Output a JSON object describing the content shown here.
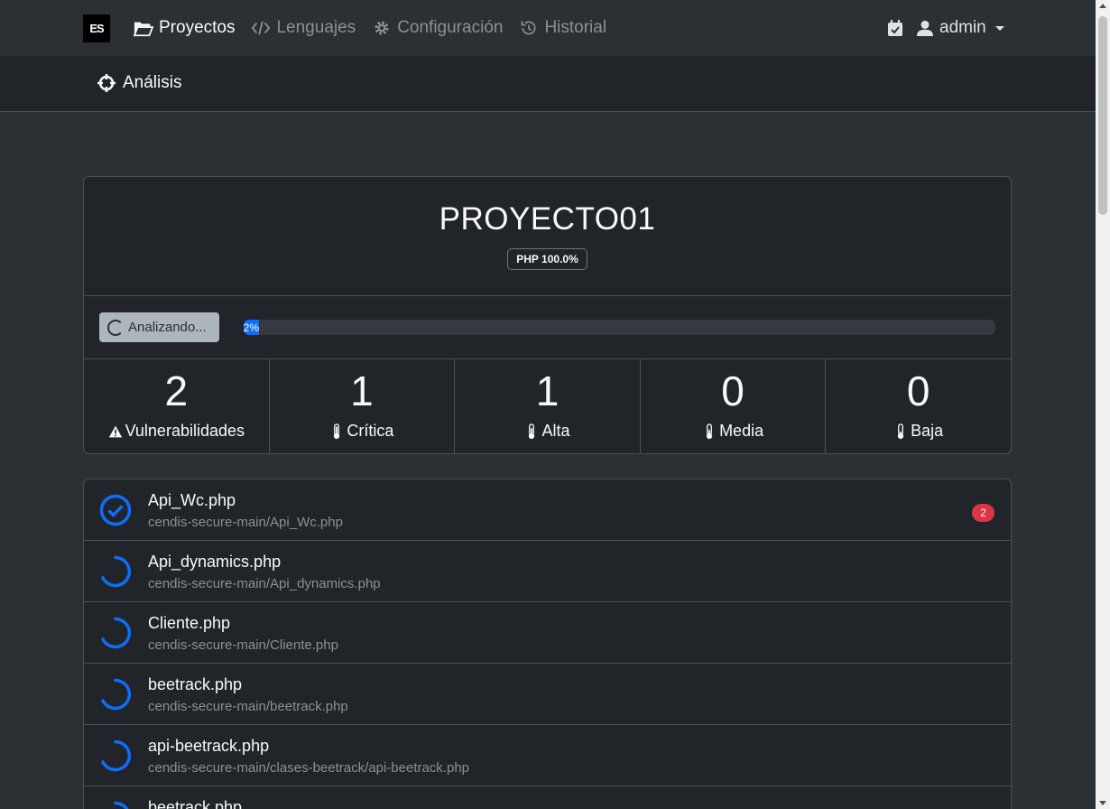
{
  "brand": {
    "logo_text": "ES"
  },
  "nav": {
    "items": [
      {
        "label": "Proyectos",
        "icon": "folder-open-icon",
        "active": true
      },
      {
        "label": "Lenguajes",
        "icon": "code-icon",
        "active": false
      },
      {
        "label": "Configuración",
        "icon": "gear-icon",
        "active": false
      },
      {
        "label": "Historial",
        "icon": "history-icon",
        "active": false
      }
    ],
    "user": {
      "name": "admin",
      "icon": "user-icon"
    },
    "calendar_icon": "calendar-check-icon"
  },
  "subnav": {
    "label": "Análisis",
    "icon": "crosshairs-icon"
  },
  "project": {
    "title": "PROYECTO01",
    "language_badge": "PHP 100.0%",
    "analyze_button": "Analizando...",
    "progress": {
      "percent": 2,
      "label": "2%"
    }
  },
  "stats": [
    {
      "value": "2",
      "label": "Vulnerabilidades",
      "icon": "warning-icon"
    },
    {
      "value": "1",
      "label": "Crítica",
      "icon": "thermometer-icon"
    },
    {
      "value": "1",
      "label": "Alta",
      "icon": "thermometer-icon"
    },
    {
      "value": "0",
      "label": "Media",
      "icon": "thermometer-icon"
    },
    {
      "value": "0",
      "label": "Baja",
      "icon": "thermometer-icon"
    }
  ],
  "files": [
    {
      "name": "Api_Wc.php",
      "path": "cendis-secure-main/Api_Wc.php",
      "status": "done",
      "count": "2"
    },
    {
      "name": "Api_dynamics.php",
      "path": "cendis-secure-main/Api_dynamics.php",
      "status": "loading"
    },
    {
      "name": "Cliente.php",
      "path": "cendis-secure-main/Cliente.php",
      "status": "loading"
    },
    {
      "name": "beetrack.php",
      "path": "cendis-secure-main/beetrack.php",
      "status": "loading"
    },
    {
      "name": "api-beetrack.php",
      "path": "cendis-secure-main/clases-beetrack/api-beetrack.php",
      "status": "loading"
    },
    {
      "name": "beetrack.php",
      "path": "",
      "status": "loading"
    }
  ],
  "colors": {
    "accent": "#0d6efd",
    "danger": "#dc3545",
    "background": "#2b3035",
    "card": "#212529"
  }
}
